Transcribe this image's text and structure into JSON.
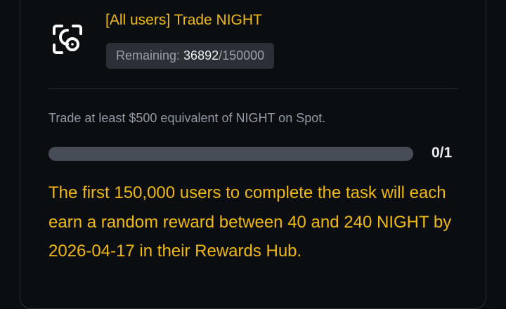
{
  "task": {
    "title": "[All users] Trade NIGHT",
    "icon": "scan-target-icon",
    "remaining_label": "Remaining: ",
    "remaining_current": "36892",
    "remaining_total": "/150000",
    "description": "Trade at least $500 equivalent of NIGHT on Spot.",
    "progress_text": "0/1",
    "progress_fraction": 0,
    "reward_text": "The first 150,000 users to complete the task will each earn a random reward between 40 and 240 NIGHT by 2026-04-17 in their Rewards Hub."
  },
  "colors": {
    "accent": "#f0b90b",
    "background": "#0b0e11",
    "track": "#474d57"
  }
}
